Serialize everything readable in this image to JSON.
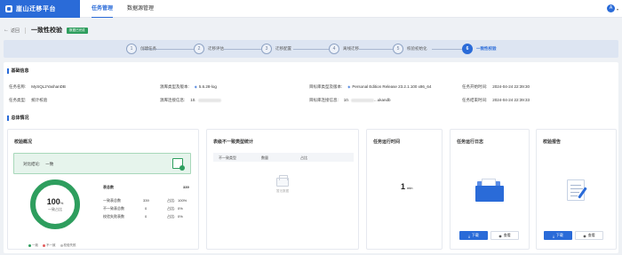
{
  "app": {
    "title": "崖山迁移平台"
  },
  "nav": {
    "tabs": [
      {
        "label": "任务管理"
      },
      {
        "label": "数据源管理"
      }
    ]
  },
  "user": {
    "avatar": "A"
  },
  "header": {
    "back_label": "返回",
    "title": "一致性校验",
    "status": "数据已完成"
  },
  "steps": [
    {
      "num": "1",
      "label": "创建任务"
    },
    {
      "num": "2",
      "label": "迁移评估"
    },
    {
      "num": "3",
      "label": "迁移配置"
    },
    {
      "num": "4",
      "label": "离线迁移"
    },
    {
      "num": "5",
      "label": "校验初始化"
    },
    {
      "num": "6",
      "label": "一致性校验"
    }
  ],
  "basic_info": {
    "title": "基础信息",
    "task_name_label": "任务名称:",
    "task_name": "MySQL2YashanDB",
    "task_type_label": "任务类型:",
    "task_type": "统计校验",
    "source_version_label": "源库类型及版本:",
    "source_version": "5.6.28-log",
    "source_conn_label": "源库连接信息:",
    "source_conn": "10.",
    "target_version_label": "目标库类型及版本:",
    "target_version": "Personal Edition Release 23.2.1.100 x86_64",
    "target_conn_label": "目标库连接信息:",
    "target_conn_prefix": "10.",
    "target_conn_suffix": "...ukandb",
    "start_time_label": "任务开始时间:",
    "start_time": "2024-04-24 22:39:30",
    "end_time_label": "任务结束时间:",
    "end_time": "2024-04-24 22:39:33"
  },
  "overview": {
    "title": "总体情况"
  },
  "summary_card": {
    "title": "校验概况",
    "conclusion_label": "对比结论:",
    "conclusion": "一致",
    "donut_percent": "100",
    "donut_unit": "%",
    "donut_label": "一致占比",
    "consistent_fraction": 1.0,
    "stats": {
      "total_label": "表总数",
      "total": "339",
      "rows": [
        {
          "label": "一致表总数",
          "value": "339",
          "ratio_label": "占比:",
          "ratio": "100%"
        },
        {
          "label": "不一致表总数",
          "value": "0",
          "ratio_label": "占比:",
          "ratio": "0%"
        },
        {
          "label": "校验失败表数",
          "value": "0",
          "ratio_label": "占比:",
          "ratio": "0%"
        }
      ]
    },
    "legend": [
      {
        "label": "一致",
        "color": "#2e9e5e"
      },
      {
        "label": "不一致",
        "color": "#e35d5d"
      },
      {
        "label": "校验失败",
        "color": "#bfbfbf"
      }
    ]
  },
  "mismatch_card": {
    "title": "表级不一致类型统计",
    "columns": [
      "不一致类型",
      "数量",
      "占比"
    ],
    "empty_text": "暂无数据"
  },
  "time_card": {
    "title": "任务运行时间",
    "value": "1",
    "unit": "min"
  },
  "log_card": {
    "title": "任务运行日志",
    "download": "下载",
    "view": "查看"
  },
  "report_card": {
    "title": "校验报告",
    "download": "下载",
    "view": "查看"
  },
  "colors": {
    "brand": "#2a6bd8",
    "success": "#2e9e5e"
  }
}
